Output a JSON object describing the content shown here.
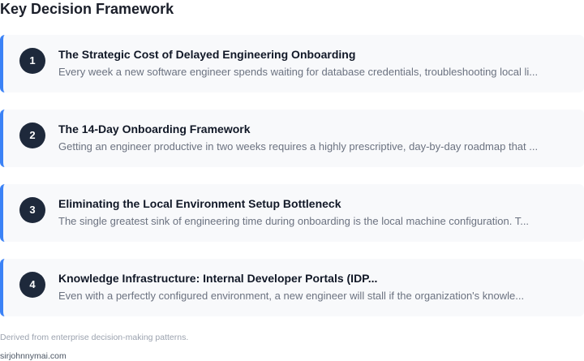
{
  "page": {
    "title": "Key Decision Framework",
    "footnote": "Derived from enterprise decision-making patterns.",
    "site": "sirjohnnymai.com"
  },
  "items": [
    {
      "number": "1",
      "title": "The Strategic Cost of Delayed Engineering Onboarding",
      "description": "Every week a new software engineer spends waiting for database credentials, troubleshooting local li..."
    },
    {
      "number": "2",
      "title": "The 14-Day Onboarding Framework",
      "description": "Getting an engineer productive in two weeks requires a highly prescriptive, day-by-day roadmap that ..."
    },
    {
      "number": "3",
      "title": "Eliminating the Local Environment Setup Bottleneck",
      "description": "The single greatest sink of engineering time during onboarding is the local machine configuration. T..."
    },
    {
      "number": "4",
      "title": "Knowledge Infrastructure: Internal Developer Portals (IDP...",
      "description": "Even with a perfectly configured environment, a new engineer will stall if the organization's knowle..."
    }
  ],
  "colors": {
    "accent": "#3b82f6",
    "badge": "#1e293b",
    "card_background": "#f8f9fb"
  }
}
